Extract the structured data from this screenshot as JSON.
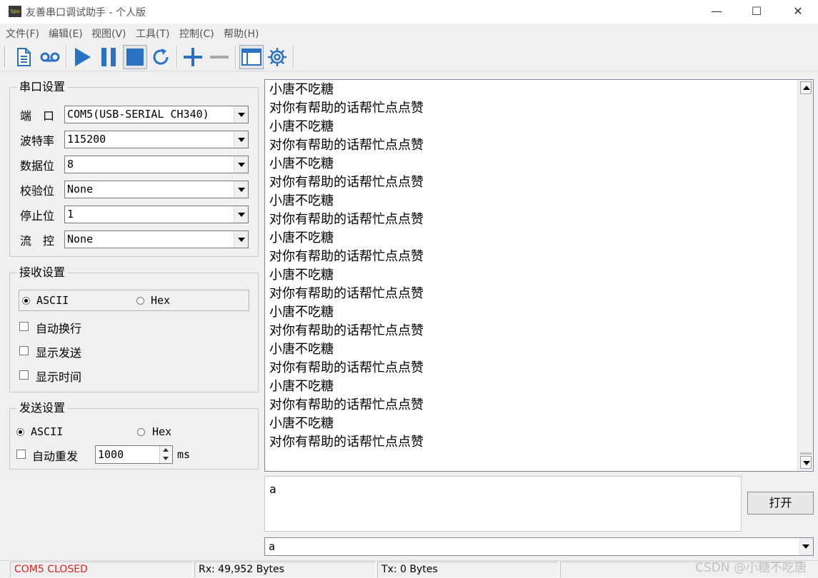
{
  "window": {
    "title": "友善串口调试助手 - 个人版",
    "icon_label": "Spu"
  },
  "title_controls": {
    "minimize": "—",
    "maximize": "☐",
    "close": "✕"
  },
  "menu": [
    "文件(F)",
    "编辑(E)",
    "视图(V)",
    "工具(T)",
    "控制(C)",
    "帮助(H)"
  ],
  "toolbar": {
    "icons": [
      "document-icon",
      "record-icon",
      "play-icon",
      "pause-icon",
      "stop-icon",
      "refresh-icon",
      "plus-icon",
      "minus-icon",
      "window-icon",
      "gear-icon"
    ],
    "accent": "#2a72c4"
  },
  "serial_settings": {
    "title": "串口设置",
    "port": {
      "label": "端　口",
      "value": "COM5(USB-SERIAL CH340)"
    },
    "baud": {
      "label": "波特率",
      "value": "115200"
    },
    "data_bits": {
      "label": "数据位",
      "value": "8"
    },
    "parity": {
      "label": "校验位",
      "value": "None"
    },
    "stop_bits": {
      "label": "停止位",
      "value": "1"
    },
    "flow": {
      "label": "流　控",
      "value": "None"
    }
  },
  "receive_settings": {
    "title": "接收设置",
    "ascii": "ASCII",
    "hex": "Hex",
    "selected": "ASCII",
    "auto_newline": {
      "label": "自动换行",
      "checked": false
    },
    "show_send": {
      "label": "显示发送",
      "checked": false
    },
    "show_time": {
      "label": "显示时间",
      "checked": false
    }
  },
  "send_settings": {
    "title": "发送设置",
    "ascii": "ASCII",
    "hex": "Hex",
    "selected": "ASCII",
    "auto_resend": {
      "label": "自动重发",
      "checked": false
    },
    "interval": "1000",
    "unit": "ms"
  },
  "receive_lines": [
    "小唐不吃糖",
    "对你有帮助的话帮忙点点赞",
    "小唐不吃糖",
    "对你有帮助的话帮忙点点赞",
    "小唐不吃糖",
    "对你有帮助的话帮忙点点赞",
    "小唐不吃糖",
    "对你有帮助的话帮忙点点赞",
    "小唐不吃糖",
    "对你有帮助的话帮忙点点赞",
    "小唐不吃糖",
    "对你有帮助的话帮忙点点赞",
    "小唐不吃糖",
    "对你有帮助的话帮忙点点赞",
    "小唐不吃糖",
    "对你有帮助的话帮忙点点赞",
    "小唐不吃糖",
    "对你有帮助的话帮忙点点赞",
    "小唐不吃糖",
    "对你有帮助的话帮忙点点赞"
  ],
  "send": {
    "text": "a",
    "open_button": "打开",
    "history_value": "a"
  },
  "status": {
    "port_state": "COM5 CLOSED",
    "port_state_color": "#e02020",
    "rx": "Rx: 49,952 Bytes",
    "tx": "Tx: 0 Bytes"
  },
  "watermark": "CSDN @小糖不吃唐"
}
